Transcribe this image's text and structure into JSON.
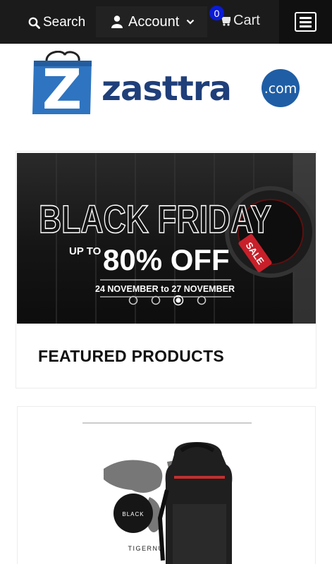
{
  "topbar": {
    "search_label": "Search",
    "account_label": "Account",
    "cart_label": "Cart",
    "cart_count": "0",
    "badge_color": "#0a1bd6",
    "icons": [
      "search-icon",
      "user-icon",
      "chevron-down-icon",
      "cart-icon",
      "menu-icon"
    ]
  },
  "logo": {
    "bag_letter": "Z",
    "brand": "zasttra",
    "suffix": ".com",
    "brand_color": "#1f3f7a",
    "bag_color": "#2e74c0"
  },
  "banner": {
    "headline": "BLACK FRIDAY",
    "upto": "UP TO",
    "discount": "80% OFF",
    "dates": "24 NOVEMBER to 27 NOVEMBER",
    "tag": "SALE",
    "slides": 4,
    "active_slide": 3
  },
  "featured": {
    "title": "FEATURED PRODUCTS"
  },
  "product": {
    "badge": "BLACK",
    "maker": "TIGERNU"
  }
}
